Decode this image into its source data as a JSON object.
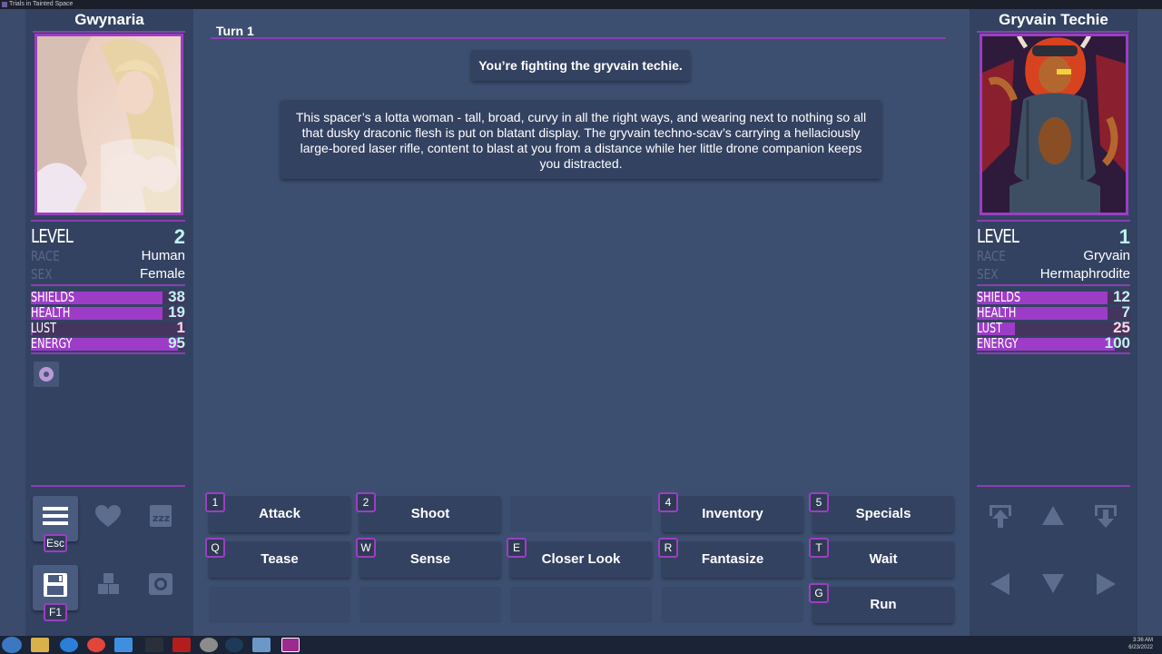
{
  "window": {
    "title": "Trials in Tainted Space"
  },
  "player": {
    "name": "Gwynaria",
    "level_label": "LEVEL",
    "level": "2",
    "race_label": "RACE",
    "race": "Human",
    "sex_label": "SEX",
    "sex": "Female",
    "stats": [
      {
        "label": "SHIELDS",
        "value": "38",
        "fill": 0.85
      },
      {
        "label": "HEALTH",
        "value": "19",
        "fill": 0.85
      },
      {
        "label": "LUST",
        "value": "1",
        "fill": 0.01
      },
      {
        "label": "ENERGY",
        "value": "95",
        "fill": 0.95
      }
    ]
  },
  "enemy": {
    "name": "Gryvain Techie",
    "level_label": "LEVEL",
    "level": "1",
    "race_label": "RACE",
    "race": "Gryvain",
    "sex_label": "SEX",
    "sex": "Hermaphrodite",
    "stats": [
      {
        "label": "SHIELDS",
        "value": "12",
        "fill": 0.85
      },
      {
        "label": "HEALTH",
        "value": "7",
        "fill": 0.85
      },
      {
        "label": "LUST",
        "value": "25",
        "fill": 0.25
      },
      {
        "label": "ENERGY",
        "value": "100",
        "fill": 0.9
      }
    ]
  },
  "combat": {
    "turn": "Turn 1",
    "headline": "You’re fighting the gryvain techie.",
    "description": "This spacer’s a lotta woman - tall, broad, curvy in all the right ways, and wearing next to nothing so all that dusky draconic flesh is put on blatant display. The gryvain techno-scav’s carrying a hellaciously large-bored laser rifle, content to blast at you from a distance while her little drone companion keeps you distracted."
  },
  "actions": {
    "row1": [
      {
        "key": "1",
        "label": "Attack"
      },
      {
        "key": "2",
        "label": "Shoot"
      },
      {
        "key": "",
        "label": ""
      },
      {
        "key": "4",
        "label": "Inventory"
      },
      {
        "key": "5",
        "label": "Specials"
      }
    ],
    "row2": [
      {
        "key": "Q",
        "label": "Tease"
      },
      {
        "key": "W",
        "label": "Sense"
      },
      {
        "key": "E",
        "label": "Closer Look"
      },
      {
        "key": "R",
        "label": "Fantasize"
      },
      {
        "key": "T",
        "label": "Wait"
      }
    ],
    "row3": [
      {
        "key": "",
        "label": ""
      },
      {
        "key": "",
        "label": ""
      },
      {
        "key": "",
        "label": ""
      },
      {
        "key": "",
        "label": ""
      },
      {
        "key": "G",
        "label": "Run"
      }
    ]
  },
  "menu": {
    "esc_key": "Esc",
    "f1_key": "F1"
  },
  "taskbar": {
    "time": "3:36 AM",
    "date": "6/23/2022"
  },
  "colors": {
    "accent": "#9b3fc2",
    "panel": "#334261",
    "background": "#3d4f70"
  }
}
